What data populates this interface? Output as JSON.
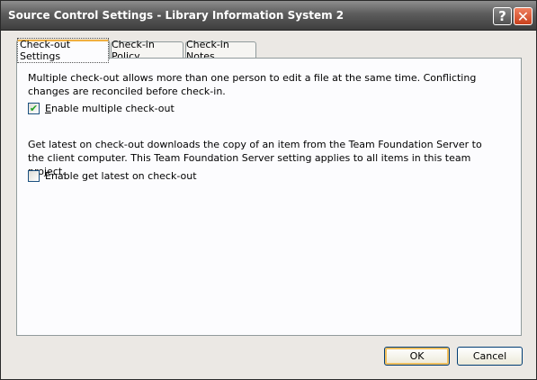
{
  "window": {
    "title": "Source Control Settings - Library Information System 2",
    "help_glyph": "?",
    "close_glyph": "✕"
  },
  "tabs": [
    {
      "label": "Check-out Settings",
      "active": true
    },
    {
      "label": "Check-in Policy",
      "active": false
    },
    {
      "label": "Check-in Notes",
      "active": false
    }
  ],
  "checkout": {
    "multiple_description": "Multiple check-out allows more than one person to edit a file at the same time. Conflicting changes are reconciled before check-in.",
    "multiple_checkbox": {
      "label_accel": "E",
      "label_rest": "nable multiple check-out",
      "checked": true,
      "check_glyph": "✔"
    },
    "latest_description": "Get latest on check-out downloads the copy of an item from the Team Foundation Server to the client computer. This Team Foundation Server setting applies to all items in this team project.",
    "latest_checkbox": {
      "label": "Enable get latest on check-out",
      "checked": false
    }
  },
  "buttons": {
    "ok": "OK",
    "cancel": "Cancel"
  }
}
